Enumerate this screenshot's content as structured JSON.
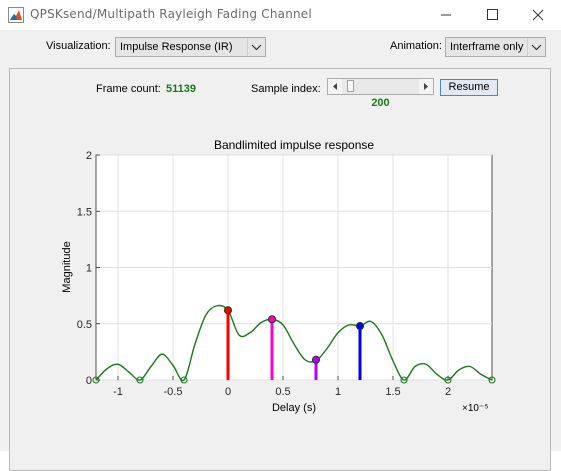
{
  "window": {
    "title": "QPSKsend/Multipath Rayleigh Fading Channel"
  },
  "toolbar": {
    "visualization_label": "Visualization:",
    "visualization_value": "Impulse Response (IR)",
    "animation_label": "Animation:",
    "animation_value": "Interframe only"
  },
  "status": {
    "frame_count_label": "Frame count:",
    "frame_count_value": "51139",
    "sample_index_label": "Sample index:",
    "sample_index_value": "200",
    "resume_label": "Resume"
  },
  "colors": {
    "curve": "#1a7a1a",
    "path1": "#ff0000",
    "path2": "#ff00cc",
    "path3": "#b000ff",
    "path4": "#0000ff",
    "value_text": "#1a7a1a"
  },
  "chart_data": {
    "type": "line",
    "title": "Bandlimited impulse response",
    "xlabel": "Delay (s)",
    "ylabel": "Magnitude",
    "x_multiplier": "×10⁻⁵",
    "xlim": [
      -1.2,
      2.4
    ],
    "ylim": [
      0,
      2
    ],
    "xticks": [
      -1,
      -0.5,
      0,
      0.5,
      1,
      1.5,
      2
    ],
    "xtick_labels": [
      "-1",
      "-0.5",
      "0",
      "0.5",
      "1",
      "1.5",
      "2"
    ],
    "yticks": [
      0,
      0.5,
      1,
      1.5,
      2
    ],
    "ytick_labels": [
      "0",
      "0.5",
      "1",
      "1.5",
      "2"
    ],
    "grid": true,
    "curve": {
      "x": [
        -1.2,
        -1.1,
        -1.0,
        -0.9,
        -0.8,
        -0.7,
        -0.6,
        -0.5,
        -0.4,
        -0.3,
        -0.2,
        -0.1,
        0.0,
        0.1,
        0.2,
        0.3,
        0.4,
        0.5,
        0.6,
        0.7,
        0.8,
        0.9,
        1.0,
        1.1,
        1.2,
        1.3,
        1.4,
        1.5,
        1.6,
        1.7,
        1.8,
        1.9,
        2.0,
        2.1,
        2.2,
        2.3,
        2.4
      ],
      "y": [
        0.0,
        0.1,
        0.14,
        0.07,
        0.0,
        0.12,
        0.23,
        0.13,
        0.0,
        0.32,
        0.58,
        0.66,
        0.62,
        0.4,
        0.42,
        0.51,
        0.54,
        0.49,
        0.32,
        0.18,
        0.17,
        0.28,
        0.42,
        0.49,
        0.48,
        0.52,
        0.4,
        0.17,
        0.0,
        0.12,
        0.14,
        0.05,
        0.0,
        0.09,
        0.12,
        0.05,
        0.0
      ]
    },
    "zero_markers_x": [
      -1.2,
      -0.8,
      -0.4,
      1.6,
      2.0,
      2.4
    ],
    "paths": [
      {
        "delay": 0.0,
        "magnitude": 0.62,
        "color": "#ff0000"
      },
      {
        "delay": 0.4,
        "magnitude": 0.54,
        "color": "#ff00cc"
      },
      {
        "delay": 0.8,
        "magnitude": 0.18,
        "color": "#b000ff"
      },
      {
        "delay": 1.2,
        "magnitude": 0.48,
        "color": "#0000ff"
      }
    ]
  }
}
